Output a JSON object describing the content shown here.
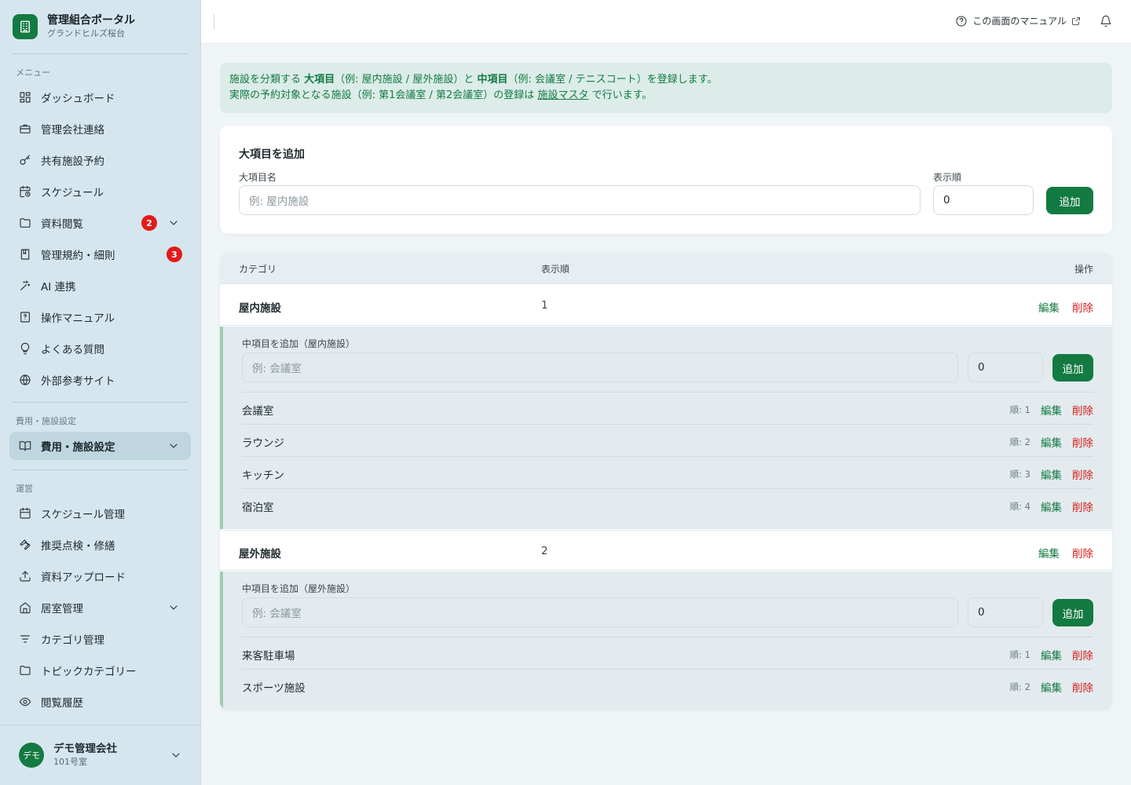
{
  "app": {
    "title": "管理組合ポータル",
    "subtitle": "グランドヒルズ桜台"
  },
  "sidebar": {
    "menu_label": "メニュー",
    "menu_items": [
      {
        "label": "ダッシュボード",
        "icon": "dashboard-icon"
      },
      {
        "label": "管理会社連絡",
        "icon": "briefcase-icon"
      },
      {
        "label": "共有施設予約",
        "icon": "key-icon"
      },
      {
        "label": "スケジュール",
        "icon": "calendar-clock-icon"
      },
      {
        "label": "資料閲覧",
        "icon": "folder-icon",
        "badge": "2"
      },
      {
        "label": "管理規約・細則",
        "icon": "book-icon",
        "badge": "3"
      },
      {
        "label": "AI 連携",
        "icon": "sparkle-icon"
      },
      {
        "label": "操作マニュアル",
        "icon": "manual-icon"
      },
      {
        "label": "よくある質問",
        "icon": "lightbulb-icon"
      },
      {
        "label": "外部参考サイト",
        "icon": "globe-icon"
      }
    ],
    "settings_label": "費用・施設設定",
    "settings_item": {
      "label": "費用・施設設定",
      "icon": "open-book-icon"
    },
    "ops_label": "運営",
    "ops_items": [
      {
        "label": "スケジュール管理",
        "icon": "calendar-icon"
      },
      {
        "label": "推奨点検・修繕",
        "icon": "wrench-icon"
      },
      {
        "label": "資料アップロード",
        "icon": "upload-icon"
      },
      {
        "label": "居室管理",
        "icon": "home-icon"
      },
      {
        "label": "カテゴリ管理",
        "icon": "filter-icon"
      },
      {
        "label": "トピックカテゴリー",
        "icon": "folder-icon"
      },
      {
        "label": "閲覧履歴",
        "icon": "eye-icon"
      }
    ],
    "user": {
      "avatar_text": "デモ",
      "name": "デモ管理会社",
      "room": "101号室"
    }
  },
  "header": {
    "manual_link": "この画面のマニュアル"
  },
  "info": {
    "line1_a": "施設を分類する ",
    "line1_b": "大項目",
    "line1_c": "（例: 屋内施設 / 屋外施設）と ",
    "line1_d": "中項目",
    "line1_e": "（例: 会議室 / テニスコート）を登録します。",
    "line2_a": "実際の予約対象となる施設（例: 第1会議室 / 第2会議室）の登録は ",
    "line2_link": "施設マスタ",
    "line2_b": " で行います。"
  },
  "add_major": {
    "title": "大項目を追加",
    "name_label": "大項目名",
    "name_placeholder": "例: 屋内施設",
    "order_label": "表示順",
    "order_value": "0",
    "button": "追加"
  },
  "table": {
    "headers": {
      "category": "カテゴリ",
      "order": "表示順",
      "actions": "操作"
    },
    "edit_label": "編集",
    "delete_label": "削除",
    "categories": [
      {
        "name": "屋内施設",
        "order": "1",
        "add_label": "中項目を追加（屋内施設）",
        "placeholder": "例: 会議室",
        "order_value": "0",
        "button": "追加",
        "subs": [
          {
            "name": "会議室",
            "order": "順: 1"
          },
          {
            "name": "ラウンジ",
            "order": "順: 2"
          },
          {
            "name": "キッチン",
            "order": "順: 3"
          },
          {
            "name": "宿泊室",
            "order": "順: 4"
          }
        ]
      },
      {
        "name": "屋外施設",
        "order": "2",
        "add_label": "中項目を追加（屋外施設）",
        "placeholder": "例: 会議室",
        "order_value": "0",
        "button": "追加",
        "subs": [
          {
            "name": "来客駐車場",
            "order": "順: 1"
          },
          {
            "name": "スポーツ施設",
            "order": "順: 2"
          }
        ]
      }
    ]
  },
  "colors": {
    "brand_green": "#137a42",
    "danger_red": "#d81b1b",
    "badge_red": "#e11b1b",
    "sidebar_bg": "#d6e6ee"
  }
}
